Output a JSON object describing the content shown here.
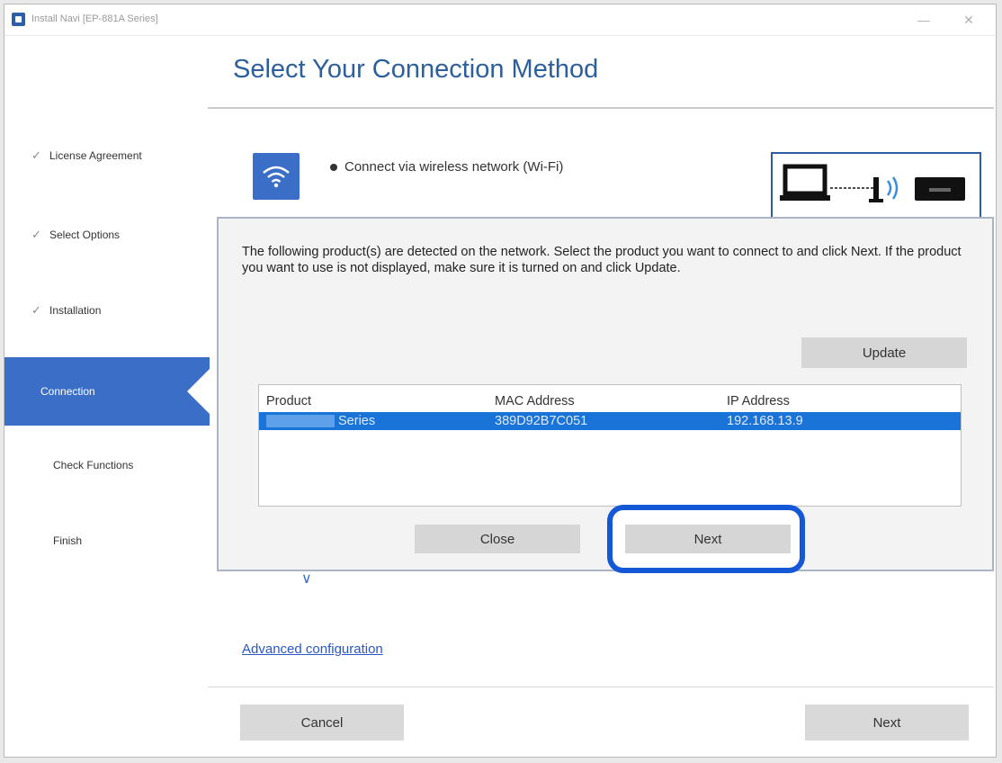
{
  "window": {
    "title": "Install Navi [EP-881A Series]",
    "minimize_glyph": "—",
    "close_glyph": "✕"
  },
  "header": {
    "title": "Select Your Connection Method"
  },
  "sidebar": {
    "check_glyph": "✓",
    "items": [
      {
        "label": "License Agreement",
        "state": "done"
      },
      {
        "label": "Select Options",
        "state": "done"
      },
      {
        "label": "Installation",
        "state": "done"
      },
      {
        "label": "Connection",
        "state": "active"
      },
      {
        "label": "Check Functions",
        "state": "pending"
      },
      {
        "label": "Finish",
        "state": "pending"
      }
    ]
  },
  "connection": {
    "wifi_option_label": "Connect via wireless network (Wi-Fi)",
    "advanced_link": "Advanced configuration",
    "expand_glyph": "∨"
  },
  "dialog": {
    "message": "The following product(s) are detected on the network. Select the product you want to connect to and click Next. If the product you want to use is not displayed, make sure it is turned on and click Update.",
    "update_label": "Update",
    "table": {
      "headers": [
        "Product",
        "MAC Address",
        "IP Address"
      ],
      "rows": [
        {
          "product": "Series",
          "mac": "389D92B7C051",
          "ip": "192.168.13.9"
        }
      ]
    },
    "close_label": "Close",
    "next_label": "Next"
  },
  "footer": {
    "cancel_label": "Cancel",
    "next_label": "Next"
  },
  "colors": {
    "accent": "#3b6fc7",
    "title_blue": "#2d5f9c",
    "selection": "#1a73d6",
    "highlight_ring": "#1458d6",
    "link": "#2a56c6"
  }
}
